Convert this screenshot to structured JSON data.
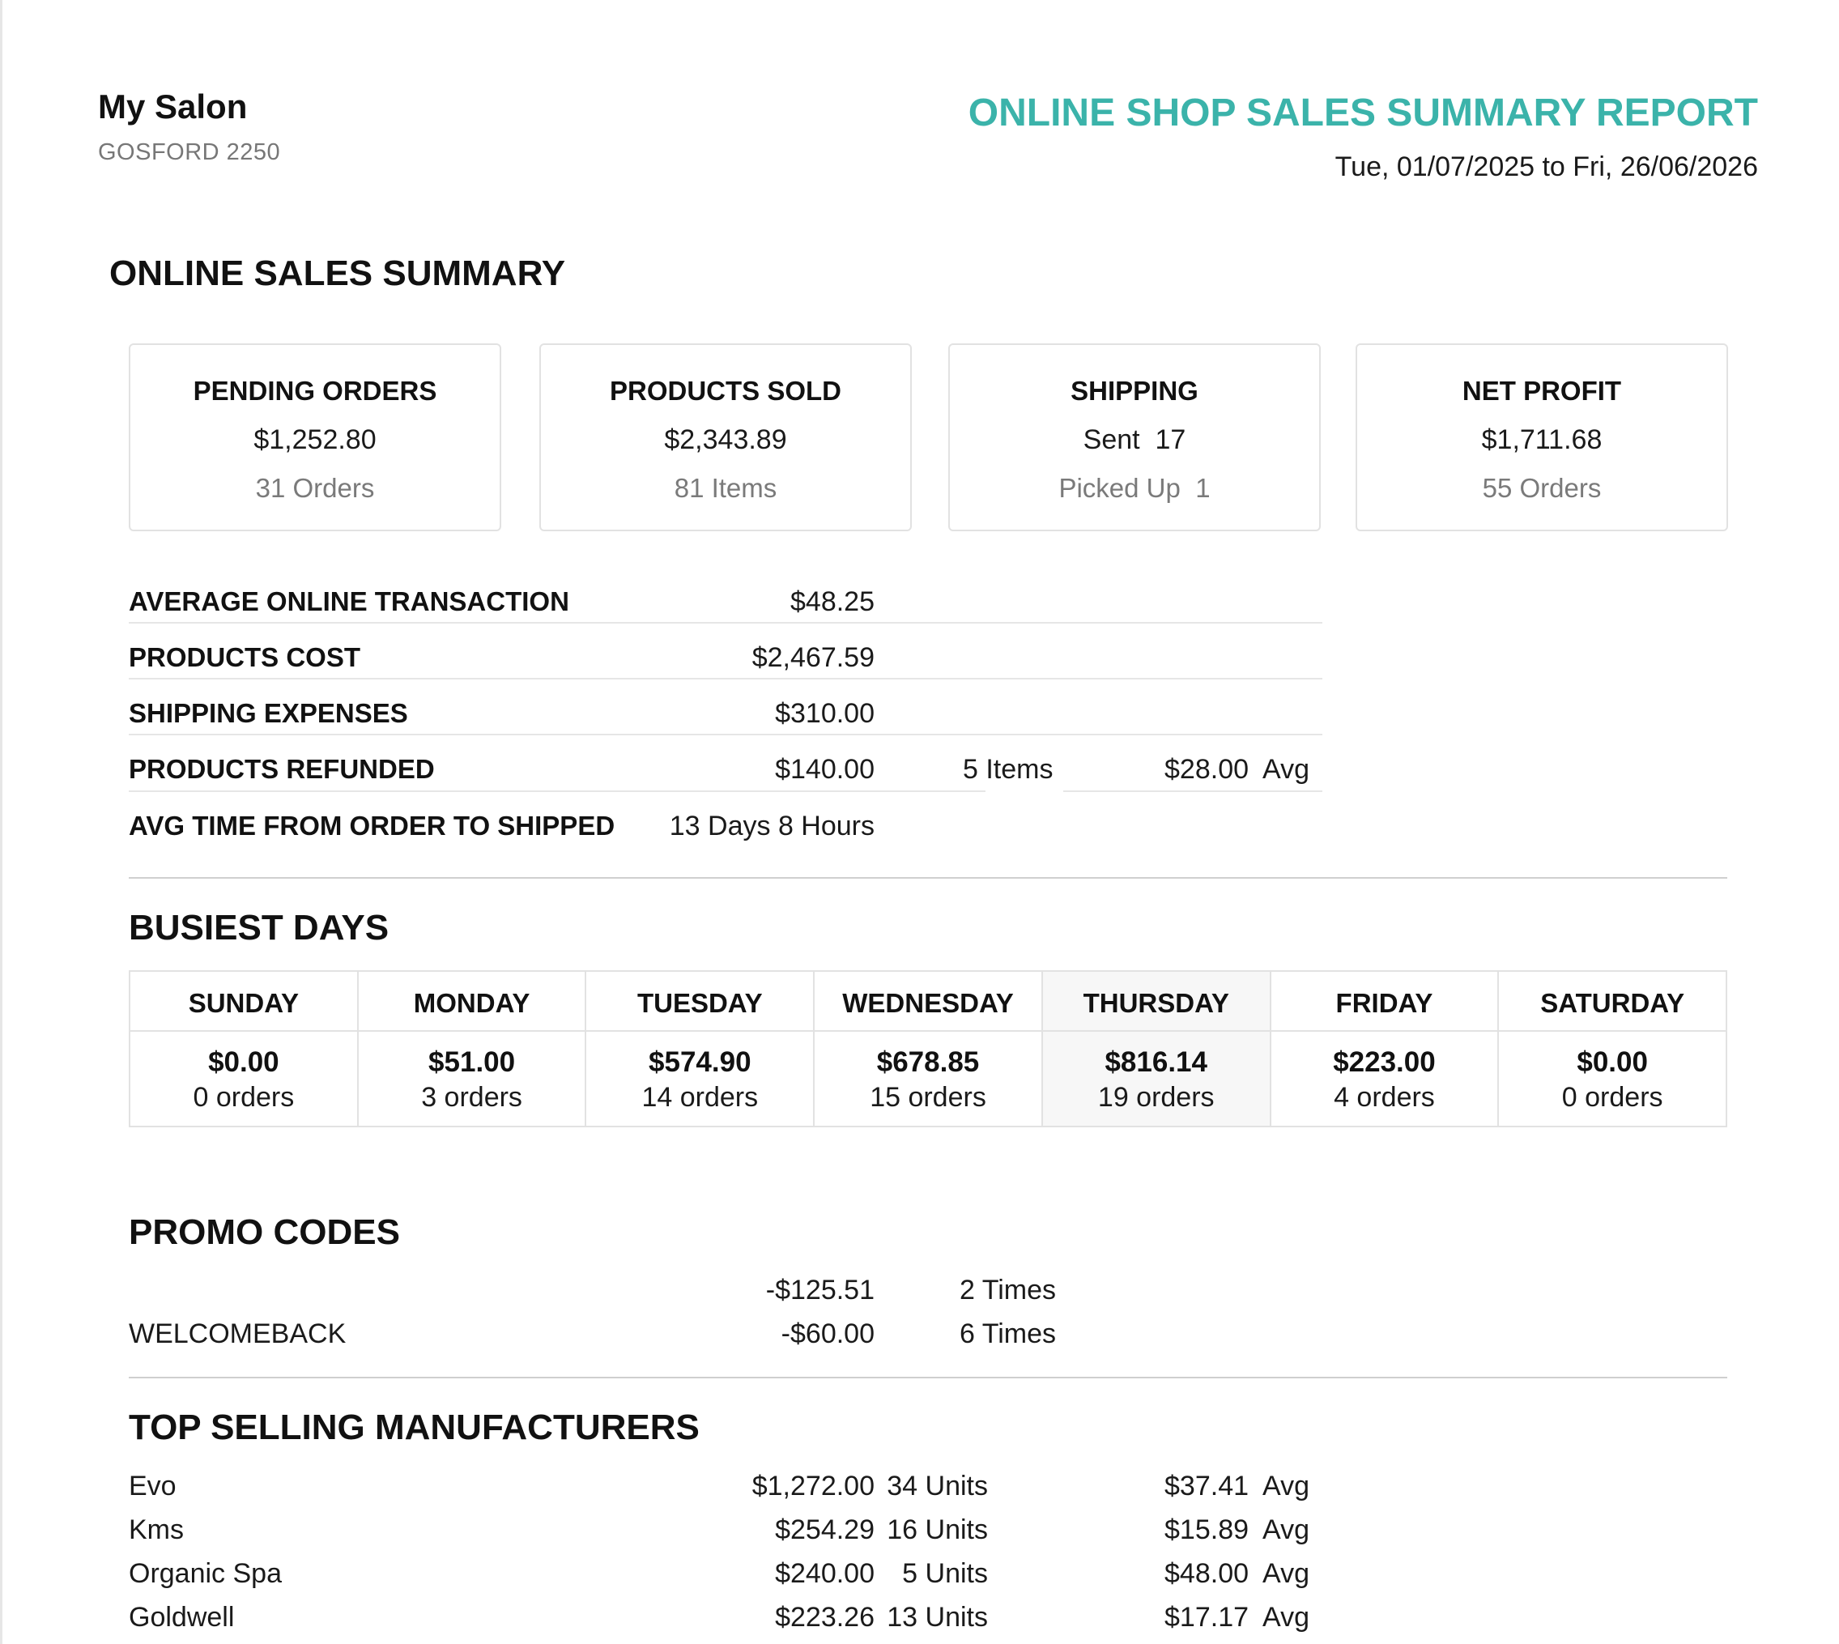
{
  "header": {
    "salon_name": "My Salon",
    "salon_location": "GOSFORD 2250",
    "report_title": "ONLINE SHOP SALES SUMMARY REPORT",
    "date_range": "Tue, 01/07/2025 to Fri, 26/06/2026"
  },
  "summary": {
    "heading": "ONLINE SALES SUMMARY",
    "cards": [
      {
        "title": "PENDING ORDERS",
        "value": "$1,252.80",
        "sub": "31 Orders"
      },
      {
        "title": "PRODUCTS SOLD",
        "value": "$2,343.89",
        "sub": "81 Items"
      },
      {
        "title": "SHIPPING",
        "value": "Sent  17",
        "sub": "Picked Up  1"
      },
      {
        "title": "NET PROFIT",
        "value": "$1,711.68",
        "sub": "55 Orders"
      }
    ],
    "stats": [
      {
        "label": "AVERAGE ONLINE TRANSACTION",
        "value": "$48.25"
      },
      {
        "label": "PRODUCTS COST",
        "value": "$2,467.59"
      },
      {
        "label": "SHIPPING EXPENSES",
        "value": "$310.00"
      },
      {
        "label": "PRODUCTS REFUNDED",
        "value": "$140.00",
        "items": "5 Items",
        "avg": "$28.00  Avg"
      },
      {
        "label": "AVG TIME FROM ORDER TO SHIPPED",
        "value": "13 Days 8 Hours"
      }
    ]
  },
  "busiest_days": {
    "heading": "BUSIEST DAYS",
    "days": [
      {
        "name": "SUNDAY",
        "amount": "$0.00",
        "orders": "0 orders"
      },
      {
        "name": "MONDAY",
        "amount": "$51.00",
        "orders": "3 orders"
      },
      {
        "name": "TUESDAY",
        "amount": "$574.90",
        "orders": "14 orders"
      },
      {
        "name": "WEDNESDAY",
        "amount": "$678.85",
        "orders": "15 orders"
      },
      {
        "name": "THURSDAY",
        "amount": "$816.14",
        "orders": "19 orders"
      },
      {
        "name": "FRIDAY",
        "amount": "$223.00",
        "orders": "4 orders"
      },
      {
        "name": "SATURDAY",
        "amount": "$0.00",
        "orders": "0 orders"
      }
    ]
  },
  "promo_codes": {
    "heading": "PROMO CODES",
    "rows": [
      {
        "code": "",
        "amount": "-$125.51",
        "times": "2 Times"
      },
      {
        "code": "WELCOMEBACK",
        "amount": "-$60.00",
        "times": "6 Times"
      }
    ]
  },
  "manufacturers": {
    "heading": "TOP SELLING MANUFACTURERS",
    "rows": [
      {
        "name": "Evo",
        "amount": "$1,272.00",
        "units": "34 Units",
        "avg": "$37.41  Avg"
      },
      {
        "name": "Kms",
        "amount": "$254.29",
        "units": "16 Units",
        "avg": "$15.89  Avg"
      },
      {
        "name": "Organic Spa",
        "amount": "$240.00",
        "units": "5 Units",
        "avg": "$48.00  Avg"
      },
      {
        "name": "Goldwell",
        "amount": "$223.26",
        "units": "13 Units",
        "avg": "$17.17  Avg"
      }
    ]
  },
  "colors": {
    "accent": "#3bb3aa",
    "muted": "#7a7a7a",
    "border": "#e2e2e2",
    "highlight_day_bg": "#f7f7f7"
  }
}
